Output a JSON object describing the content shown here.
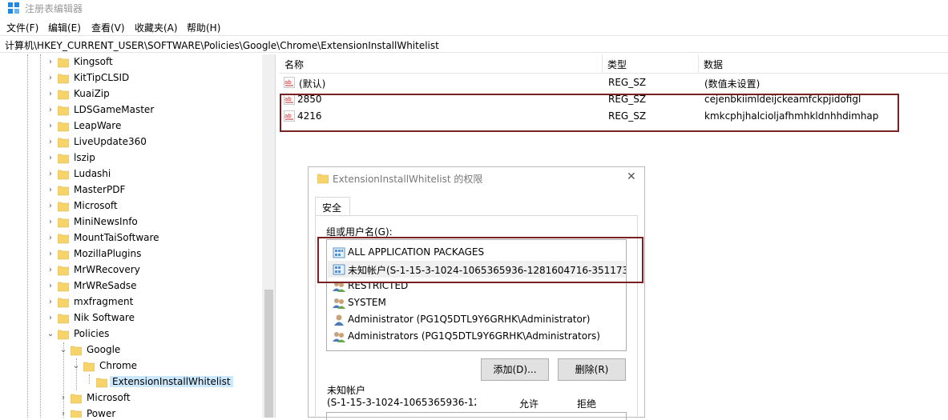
{
  "window": {
    "title": "注册表编辑器",
    "accent": "#0078d7"
  },
  "menu": [
    "文件(F)",
    "编辑(E)",
    "查看(V)",
    "收藏夹(A)",
    "帮助(H)"
  ],
  "address": "计算机\\HKEY_CURRENT_USER\\SOFTWARE\\Policies\\Google\\Chrome\\ExtensionInstallWhitelist",
  "tree": [
    {
      "label": "Kingsoft"
    },
    {
      "label": "KitTipCLSID"
    },
    {
      "label": "KuaiZip"
    },
    {
      "label": "LDSGameMaster"
    },
    {
      "label": "LeapWare"
    },
    {
      "label": "LiveUpdate360"
    },
    {
      "label": "lszip"
    },
    {
      "label": "Ludashi"
    },
    {
      "label": "MasterPDF"
    },
    {
      "label": "Microsoft"
    },
    {
      "label": "MiniNewsInfo"
    },
    {
      "label": "MountTaiSoftware"
    },
    {
      "label": "MozillaPlugins"
    },
    {
      "label": "MrWRecovery"
    },
    {
      "label": "MrWReSadse"
    },
    {
      "label": "mxfragment"
    },
    {
      "label": "Nik Software"
    },
    {
      "label": "Policies"
    },
    {
      "label": "Google"
    },
    {
      "label": "Chrome"
    },
    {
      "label": "ExtensionInstallWhitelist"
    },
    {
      "label": "Microsoft"
    },
    {
      "label": "Power"
    }
  ],
  "list": {
    "headers": [
      "名称",
      "类型",
      "数据"
    ],
    "rows": [
      {
        "name": "(默认)",
        "type": "REG_SZ",
        "data": "(数值未设置)"
      },
      {
        "name": "2850",
        "type": "REG_SZ",
        "data": "cejenbkiimldeijckeamfckpjidofigl"
      },
      {
        "name": "4216",
        "type": "REG_SZ",
        "data": "kmkcphjhalcioljafhmhkldnhhdimhap"
      }
    ]
  },
  "dialog": {
    "title": "ExtensionInstallWhitelist 的权限",
    "close": "✕",
    "tab": "安全",
    "group_label": "组或用户名(G):",
    "users": [
      {
        "name": "ALL APPLICATION PACKAGES",
        "icon": "app-packages-icon"
      },
      {
        "name": "未知帐户(S-1-15-3-1024-1065365936-1281604716-351173...",
        "icon": "unknown-account-icon"
      },
      {
        "name": "RESTRICTED",
        "icon": "group-icon"
      },
      {
        "name": "SYSTEM",
        "icon": "group-icon"
      },
      {
        "name": "Administrator (PG1Q5DTL9Y6GRHK\\Administrator)",
        "icon": "user-icon"
      },
      {
        "name": "Administrators (PG1Q5DTL9Y6GRHK\\Administrators)",
        "icon": "group-icon"
      }
    ],
    "add_button": "添加(D)...",
    "remove_button": "删除(R)",
    "perm_for": "未知帐户",
    "perm_sid": "(S-1-15-3-1024-1065365936-128",
    "allow": "允许",
    "deny": "拒绝"
  }
}
